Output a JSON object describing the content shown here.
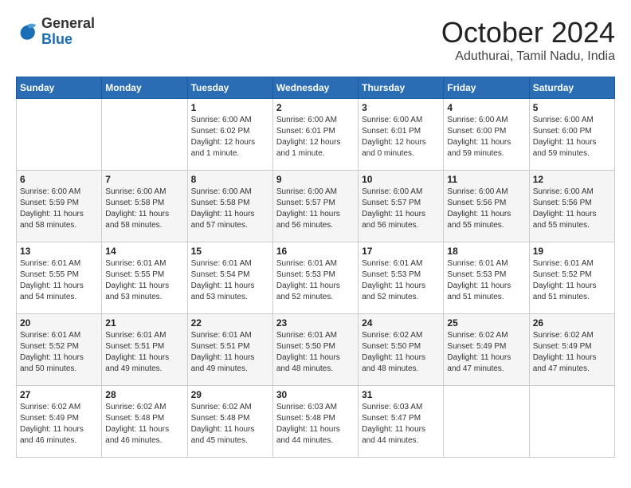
{
  "header": {
    "logo": {
      "line1": "General",
      "line2": "Blue"
    },
    "title": "October 2024",
    "subtitle": "Aduthurai, Tamil Nadu, India"
  },
  "weekdays": [
    "Sunday",
    "Monday",
    "Tuesday",
    "Wednesday",
    "Thursday",
    "Friday",
    "Saturday"
  ],
  "weeks": [
    [
      {
        "day": null,
        "info": null
      },
      {
        "day": null,
        "info": null
      },
      {
        "day": "1",
        "info": "Sunrise: 6:00 AM\nSunset: 6:02 PM\nDaylight: 12 hours\nand 1 minute."
      },
      {
        "day": "2",
        "info": "Sunrise: 6:00 AM\nSunset: 6:01 PM\nDaylight: 12 hours\nand 1 minute."
      },
      {
        "day": "3",
        "info": "Sunrise: 6:00 AM\nSunset: 6:01 PM\nDaylight: 12 hours\nand 0 minutes."
      },
      {
        "day": "4",
        "info": "Sunrise: 6:00 AM\nSunset: 6:00 PM\nDaylight: 11 hours\nand 59 minutes."
      },
      {
        "day": "5",
        "info": "Sunrise: 6:00 AM\nSunset: 6:00 PM\nDaylight: 11 hours\nand 59 minutes."
      }
    ],
    [
      {
        "day": "6",
        "info": "Sunrise: 6:00 AM\nSunset: 5:59 PM\nDaylight: 11 hours\nand 58 minutes."
      },
      {
        "day": "7",
        "info": "Sunrise: 6:00 AM\nSunset: 5:58 PM\nDaylight: 11 hours\nand 58 minutes."
      },
      {
        "day": "8",
        "info": "Sunrise: 6:00 AM\nSunset: 5:58 PM\nDaylight: 11 hours\nand 57 minutes."
      },
      {
        "day": "9",
        "info": "Sunrise: 6:00 AM\nSunset: 5:57 PM\nDaylight: 11 hours\nand 56 minutes."
      },
      {
        "day": "10",
        "info": "Sunrise: 6:00 AM\nSunset: 5:57 PM\nDaylight: 11 hours\nand 56 minutes."
      },
      {
        "day": "11",
        "info": "Sunrise: 6:00 AM\nSunset: 5:56 PM\nDaylight: 11 hours\nand 55 minutes."
      },
      {
        "day": "12",
        "info": "Sunrise: 6:00 AM\nSunset: 5:56 PM\nDaylight: 11 hours\nand 55 minutes."
      }
    ],
    [
      {
        "day": "13",
        "info": "Sunrise: 6:01 AM\nSunset: 5:55 PM\nDaylight: 11 hours\nand 54 minutes."
      },
      {
        "day": "14",
        "info": "Sunrise: 6:01 AM\nSunset: 5:55 PM\nDaylight: 11 hours\nand 53 minutes."
      },
      {
        "day": "15",
        "info": "Sunrise: 6:01 AM\nSunset: 5:54 PM\nDaylight: 11 hours\nand 53 minutes."
      },
      {
        "day": "16",
        "info": "Sunrise: 6:01 AM\nSunset: 5:53 PM\nDaylight: 11 hours\nand 52 minutes."
      },
      {
        "day": "17",
        "info": "Sunrise: 6:01 AM\nSunset: 5:53 PM\nDaylight: 11 hours\nand 52 minutes."
      },
      {
        "day": "18",
        "info": "Sunrise: 6:01 AM\nSunset: 5:53 PM\nDaylight: 11 hours\nand 51 minutes."
      },
      {
        "day": "19",
        "info": "Sunrise: 6:01 AM\nSunset: 5:52 PM\nDaylight: 11 hours\nand 51 minutes."
      }
    ],
    [
      {
        "day": "20",
        "info": "Sunrise: 6:01 AM\nSunset: 5:52 PM\nDaylight: 11 hours\nand 50 minutes."
      },
      {
        "day": "21",
        "info": "Sunrise: 6:01 AM\nSunset: 5:51 PM\nDaylight: 11 hours\nand 49 minutes."
      },
      {
        "day": "22",
        "info": "Sunrise: 6:01 AM\nSunset: 5:51 PM\nDaylight: 11 hours\nand 49 minutes."
      },
      {
        "day": "23",
        "info": "Sunrise: 6:01 AM\nSunset: 5:50 PM\nDaylight: 11 hours\nand 48 minutes."
      },
      {
        "day": "24",
        "info": "Sunrise: 6:02 AM\nSunset: 5:50 PM\nDaylight: 11 hours\nand 48 minutes."
      },
      {
        "day": "25",
        "info": "Sunrise: 6:02 AM\nSunset: 5:49 PM\nDaylight: 11 hours\nand 47 minutes."
      },
      {
        "day": "26",
        "info": "Sunrise: 6:02 AM\nSunset: 5:49 PM\nDaylight: 11 hours\nand 47 minutes."
      }
    ],
    [
      {
        "day": "27",
        "info": "Sunrise: 6:02 AM\nSunset: 5:49 PM\nDaylight: 11 hours\nand 46 minutes."
      },
      {
        "day": "28",
        "info": "Sunrise: 6:02 AM\nSunset: 5:48 PM\nDaylight: 11 hours\nand 46 minutes."
      },
      {
        "day": "29",
        "info": "Sunrise: 6:02 AM\nSunset: 5:48 PM\nDaylight: 11 hours\nand 45 minutes."
      },
      {
        "day": "30",
        "info": "Sunrise: 6:03 AM\nSunset: 5:48 PM\nDaylight: 11 hours\nand 44 minutes."
      },
      {
        "day": "31",
        "info": "Sunrise: 6:03 AM\nSunset: 5:47 PM\nDaylight: 11 hours\nand 44 minutes."
      },
      {
        "day": null,
        "info": null
      },
      {
        "day": null,
        "info": null
      }
    ]
  ]
}
